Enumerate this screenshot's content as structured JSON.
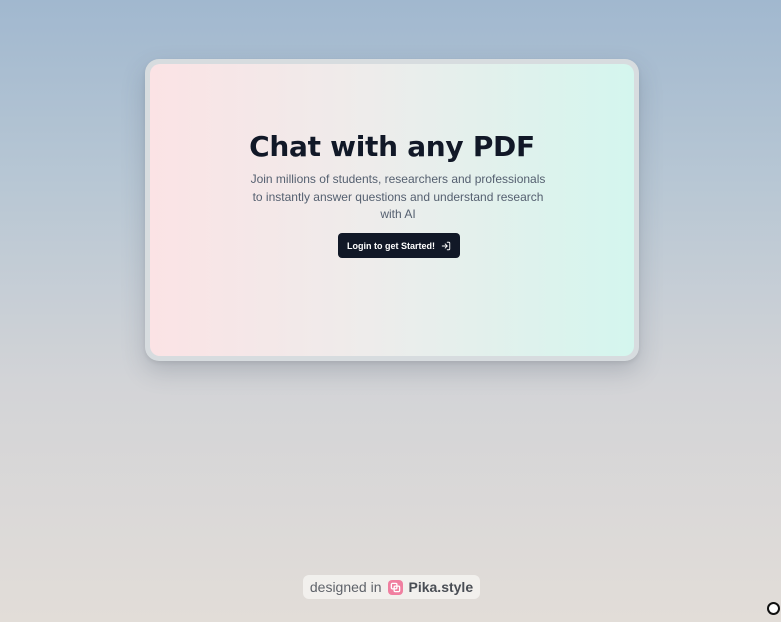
{
  "hero": {
    "title": "Chat with any PDF",
    "subtitle": "Join millions of students, researchers and professionals to instantly answer questions and understand research with AI",
    "cta_label": "Login to get Started!",
    "cta_icon": "log-in-icon"
  },
  "credit": {
    "prefix": "designed in",
    "brand": "Pika.style",
    "logo_icon": "pika-logo-icon"
  },
  "colors": {
    "cta_background": "#111827",
    "title": "#111827",
    "gradient_left": "#fbe3e5",
    "gradient_right": "#d4f6ee",
    "logo": "#f07fa0"
  }
}
